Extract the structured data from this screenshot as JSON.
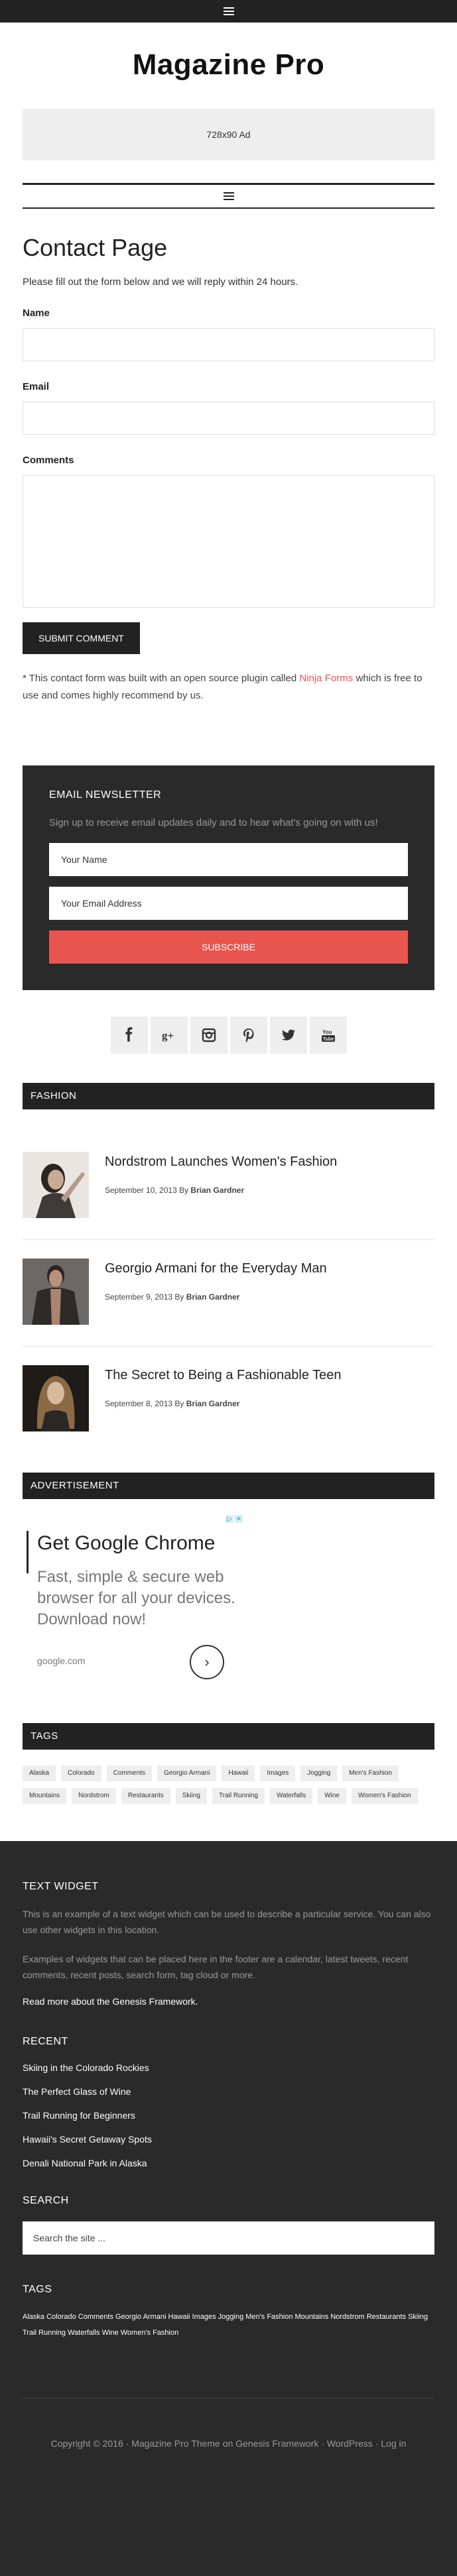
{
  "site": {
    "title": "Magazine Pro",
    "ad_banner": "728x90 Ad"
  },
  "page": {
    "title": "Contact Page",
    "intro": "Please fill out the form below and we will reply within 24 hours.",
    "form": {
      "name_label": "Name",
      "email_label": "Email",
      "comments_label": "Comments",
      "submit_label": "SUBMIT COMMENT"
    },
    "note_prefix": "* This contact form was built with an open source plugin called ",
    "note_link": "Ninja Forms",
    "note_suffix": " which is free to use and comes highly recommend by us."
  },
  "newsletter": {
    "title": "EMAIL NEWSLETTER",
    "description": "Sign up to receive email updates daily and to hear what's going on with us!",
    "name_placeholder": "Your Name",
    "email_placeholder": "Your Email Address",
    "button": "SUBSCRIBE"
  },
  "social": [
    "facebook-icon",
    "google-plus-icon",
    "instagram-icon",
    "pinterest-icon",
    "twitter-icon",
    "youtube-icon"
  ],
  "fashion": {
    "heading": "FASHION",
    "posts": [
      {
        "title": "Nordstrom Launches Women's Fashion",
        "date": "September 10, 2013 By ",
        "author": "Brian Gardner"
      },
      {
        "title": "Georgio Armani for the Everyday Man",
        "date": "September 9, 2013 By ",
        "author": "Brian Gardner"
      },
      {
        "title": "The Secret to Being a Fashionable Teen",
        "date": "September 8, 2013 By ",
        "author": "Brian Gardner"
      }
    ]
  },
  "advertisement": {
    "heading": "ADVERTISEMENT",
    "headline": "Get Google Chrome",
    "body": "Fast, simple & secure web browser for all your devices. Download now!",
    "url": "google.com"
  },
  "tags": {
    "heading": "TAGS",
    "items": [
      "Alaska",
      "Colorado",
      "Comments",
      "Georgio Armani",
      "Hawaii",
      "Images",
      "Jogging",
      "Men's Fashion",
      "Mountains",
      "Nordstrom",
      "Restaurants",
      "Skiing",
      "Trail Running",
      "Waterfalls",
      "Wine",
      "Women's Fashion"
    ]
  },
  "footer": {
    "text_widget_title": "TEXT WIDGET",
    "text_widget_p1": "This is an example of a text widget which can be used to describe a particular service. You can also use other widgets in this location.",
    "text_widget_p2": "Examples of widgets that can be placed here in the footer are a calendar, latest tweets, recent comments, recent posts, search form, tag cloud or more.",
    "text_widget_link": "Read more about the Genesis Framework.",
    "recent_title": "RECENT",
    "recent": [
      "Skiing in the Colorado Rockies",
      "The Perfect Glass of Wine",
      "Trail Running for Beginners",
      "Hawaii's Secret Getaway Spots",
      "Denali National Park in Alaska"
    ],
    "search_title": "SEARCH",
    "search_placeholder": "Search the site ...",
    "tags_title": "TAGS",
    "tag_cloud": "Alaska Colorado Comments Georgio Armani Hawaii Images Jogging Men's Fashion Mountains Nordstrom Restaurants Skiing Trail Running Waterfalls Wine Women's Fashion",
    "copyright": "Copyright © 2016 · Magazine Pro Theme on Genesis Framework · WordPress · Log in"
  }
}
